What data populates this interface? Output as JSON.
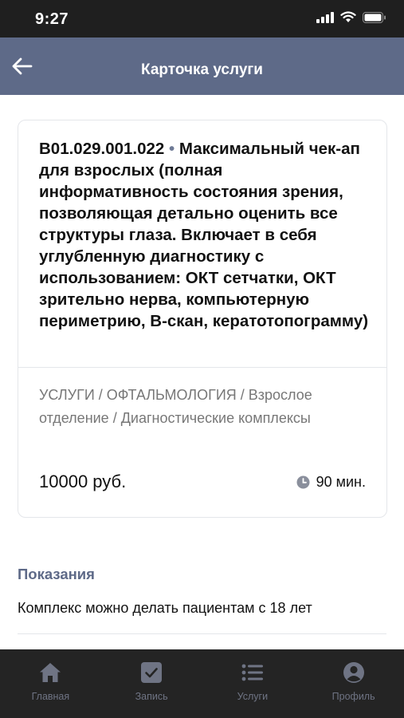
{
  "status_bar": {
    "time": "9:27"
  },
  "header": {
    "title": "Карточка услуги"
  },
  "service": {
    "code": "B01.029.001.022",
    "separator": "•",
    "name": "Максимальный чек-ап для взрослых (полная информативность состояния зрения, позволяющая детально оценить все структуры глаза. Включает в себя углубленную диагностику с использованием: ОКТ сетчатки, ОКТ зрительно нерва, компьютерную периметрию, В-скан, кератотопограмму)",
    "path": "УСЛУГИ / ОФТАЛЬМОЛОГИЯ / Взрослое отделение / Диагностические комплексы",
    "price": "10000 руб.",
    "duration": "90 мин."
  },
  "indications": {
    "title": "Показания",
    "text": "Комплекс можно делать пациентам с 18 лет"
  },
  "tabs": [
    {
      "label": "Главная",
      "icon": "home-icon"
    },
    {
      "label": "Запись",
      "icon": "checkbox-icon"
    },
    {
      "label": "Услуги",
      "icon": "list-icon"
    },
    {
      "label": "Профиль",
      "icon": "profile-icon"
    }
  ],
  "colors": {
    "header_bg": "#5e6a88",
    "tab_bar_bg": "#242424",
    "tab_inactive": "#6f7484"
  }
}
